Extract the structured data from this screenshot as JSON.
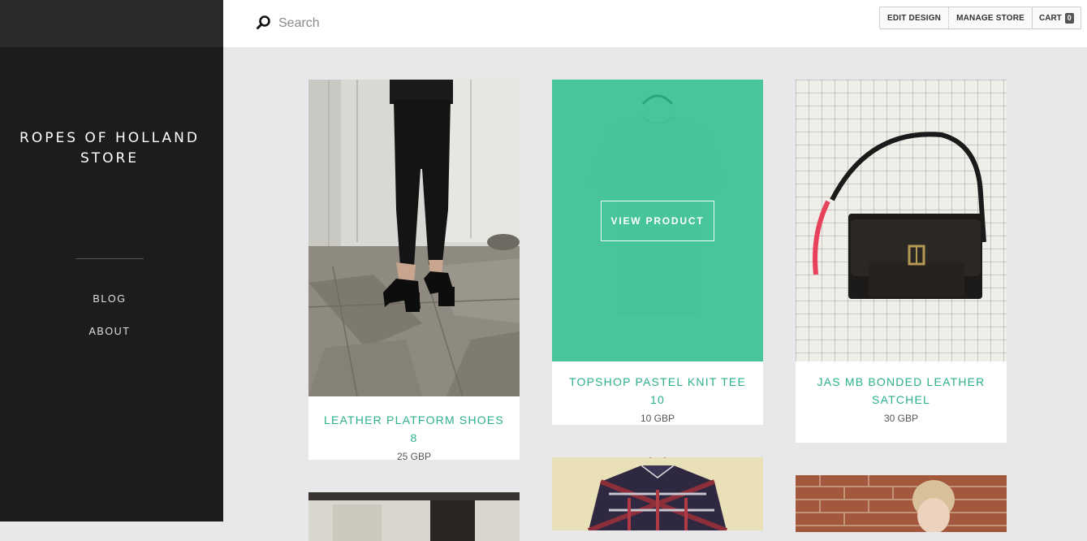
{
  "store": {
    "title": "ROPES OF HOLLAND STORE"
  },
  "nav": {
    "items": [
      {
        "label": "BLOG"
      },
      {
        "label": "ABOUT"
      }
    ]
  },
  "search": {
    "placeholder": "Search",
    "icon": "search-icon"
  },
  "admin": {
    "edit_design": "EDIT DESIGN",
    "manage_store": "MANAGE STORE"
  },
  "cart": {
    "label": "CART",
    "count": "0"
  },
  "products": [
    {
      "name": "LEATHER PLATFORM SHOES 8",
      "price": "25 GBP"
    },
    {
      "name": "TOPSHOP PASTEL KNIT TEE 10",
      "price": "10 GBP",
      "hover_label": "VIEW PRODUCT"
    },
    {
      "name": "JAS MB BONDED LEATHER SATCHEL",
      "price": "30 GBP"
    }
  ],
  "colors": {
    "accent": "#2bb08c",
    "overlay": "#26bc8c",
    "sidebar": "#1c1c1e",
    "background": "#e8e8ea"
  }
}
